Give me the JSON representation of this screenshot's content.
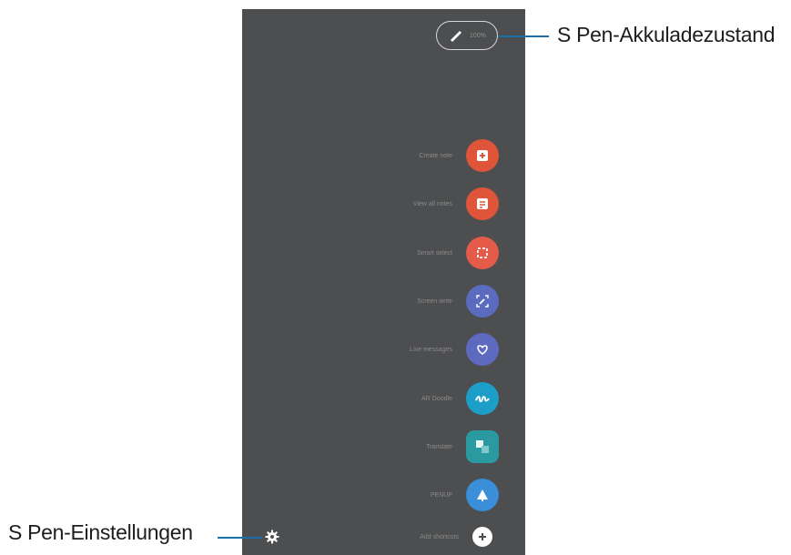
{
  "battery": {
    "percent_text": "100%"
  },
  "menu_items": [
    {
      "label": "Create note",
      "icon": "create-note-icon",
      "color": "#e0553a"
    },
    {
      "label": "View all notes",
      "icon": "view-notes-icon",
      "color": "#e0553a"
    },
    {
      "label": "Smart select",
      "icon": "smart-select-icon",
      "color": "#e45b4a"
    },
    {
      "label": "Screen write",
      "icon": "screen-write-icon",
      "color": "#5b6bbf"
    },
    {
      "label": "Live messages",
      "icon": "live-messages-icon",
      "color": "#5d6ac0"
    },
    {
      "label": "AR Doodle",
      "icon": "ar-doodle-icon",
      "color": "#1d9ec9"
    },
    {
      "label": "Translate",
      "icon": "translate-icon",
      "color": "#2a9aa0"
    },
    {
      "label": "PENUP",
      "icon": "penup-icon",
      "color": "#3b8fd9"
    },
    {
      "label": "Add shortcuts",
      "icon": "add-icon",
      "color": "#ffffff"
    }
  ],
  "callouts": {
    "battery": "S Pen-Akkuladezustand",
    "settings": "S Pen-Einstellungen"
  },
  "colors": {
    "panel": "#4d4e50",
    "callout_line": "#1a6fa8"
  }
}
